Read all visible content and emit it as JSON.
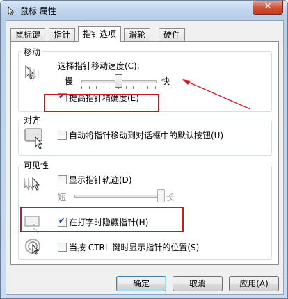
{
  "window": {
    "title": "鼠标 属性",
    "close_symbol": "✕"
  },
  "tabs": [
    {
      "label": "鼠标键"
    },
    {
      "label": "指针"
    },
    {
      "label": "指针选项"
    },
    {
      "label": "滑轮"
    },
    {
      "label": "硬件"
    }
  ],
  "motion": {
    "group_label": "移动",
    "speed_label": "选择指针移动速度(C):",
    "slow_label": "慢",
    "fast_label": "快",
    "speed_value_fraction": 0.5,
    "precision_label": "提高指针精确度(E)",
    "precision_checked": true
  },
  "snap": {
    "group_label": "对齐",
    "snap_label": "自动将指针移动到对话框中的默认按钮(U)",
    "snap_checked": false
  },
  "visibility": {
    "group_label": "可见性",
    "trails_label": "显示指针轨迹(D)",
    "trails_checked": false,
    "short_label": "短",
    "long_label": "长",
    "trails_value_fraction": 1.0,
    "hide_label": "在打字时隐藏指针(H)",
    "hide_checked": true,
    "ctrl_label": "当按 CTRL 键时显示指针的位置(S)",
    "ctrl_checked": false
  },
  "buttons": {
    "ok": "确定",
    "cancel": "取消",
    "apply": "应用(A)"
  },
  "annotation_color": "#d0161f"
}
